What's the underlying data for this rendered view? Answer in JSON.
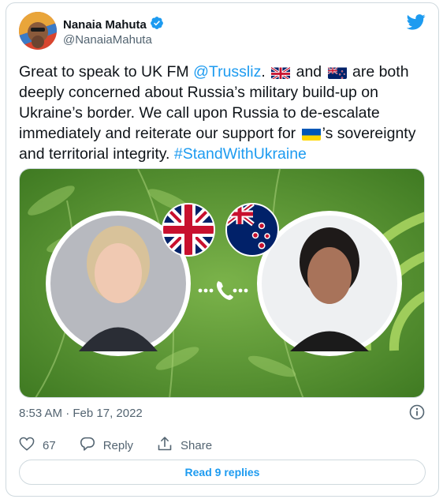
{
  "author": {
    "display_name": "Nanaia Mahuta",
    "handle": "@NanaiaMahuta",
    "verified": true
  },
  "tweet": {
    "text_1": "Great to speak to UK FM ",
    "mention": "@Trussliz",
    "text_2": ". ",
    "text_3": " and ",
    "text_4": " are both deeply concerned about Russia’s military build-up on Ukraine’s border. We call upon Russia to de-escalate immediately and reiterate our support for ",
    "text_5": "’s sovereignty and territorial integrity. ",
    "hashtag": "#StandWithUkraine"
  },
  "meta": {
    "timestamp": "8:53 AM · Feb 17, 2022"
  },
  "actions": {
    "like_count": "67",
    "reply_label": "Reply",
    "share_label": "Share"
  },
  "read_replies_label": "Read 9 replies",
  "icons": [
    "twitter-bird-icon",
    "verified-badge-icon",
    "info-icon",
    "heart-icon",
    "reply-icon",
    "share-icon",
    "phone-icon"
  ],
  "colors": {
    "accent": "#1d9bf0",
    "text": "#0f1419",
    "muted": "#536471",
    "border": "#cfd9de",
    "media_green": "#5c9a2c"
  }
}
